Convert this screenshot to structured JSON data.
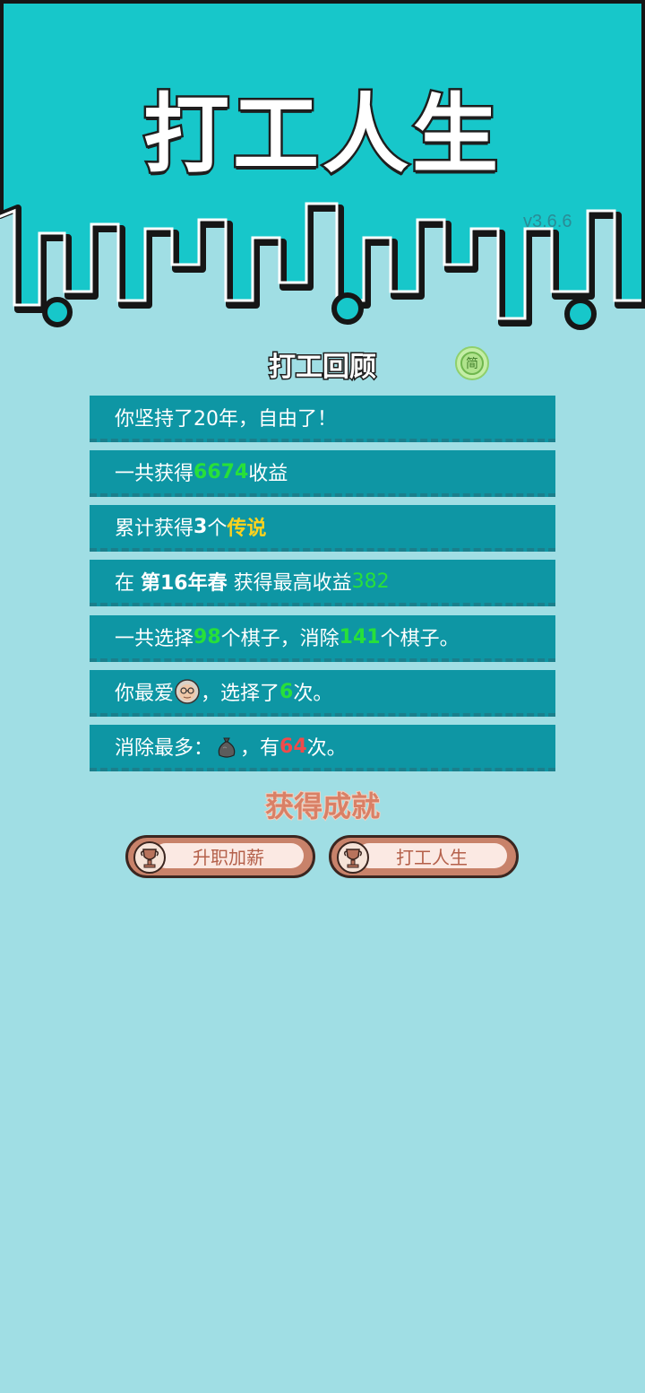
{
  "app": {
    "title": "打工人生",
    "version": "v3.6.6"
  },
  "review": {
    "title": "打工回顾",
    "lang_label": "简"
  },
  "stats": {
    "row1": {
      "text": "你坚持了20年，自由了！"
    },
    "row2": {
      "prefix": "一共获得",
      "value": "6674",
      "suffix": "收益"
    },
    "row3": {
      "prefix": "累计获得",
      "count": "3",
      "mid": "个",
      "rarity": "传说"
    },
    "row4": {
      "prefix": "在 ",
      "period": "第16年春",
      "mid": " 获得最高收益",
      "value": "382"
    },
    "row5": {
      "p1": "一共选择",
      "selected": "98",
      "p2": "个棋子，消除",
      "removed": "141",
      "p3": "个棋子。"
    },
    "row6": {
      "prefix": "你最爱",
      "icon": "old-man-face-icon",
      "mid": "，选择了",
      "count": "6",
      "suffix": "次。"
    },
    "row7": {
      "prefix": "消除最多：",
      "icon": "garbage-bag-icon",
      "mid": "，有",
      "count": "64",
      "suffix": "次。"
    }
  },
  "achievements": {
    "title": "获得成就",
    "items": [
      {
        "label": "升职加薪",
        "icon": "trophy-icon"
      },
      {
        "label": "打工人生",
        "icon": "trophy-icon"
      }
    ]
  },
  "colors": {
    "header_bg": "#17c7ca",
    "page_bg": "#a0dee4",
    "row_bg": "#0e96a4",
    "highlight_green": "#27e03a",
    "highlight_yellow": "#ffd21d",
    "highlight_red": "#ef4b4b"
  }
}
